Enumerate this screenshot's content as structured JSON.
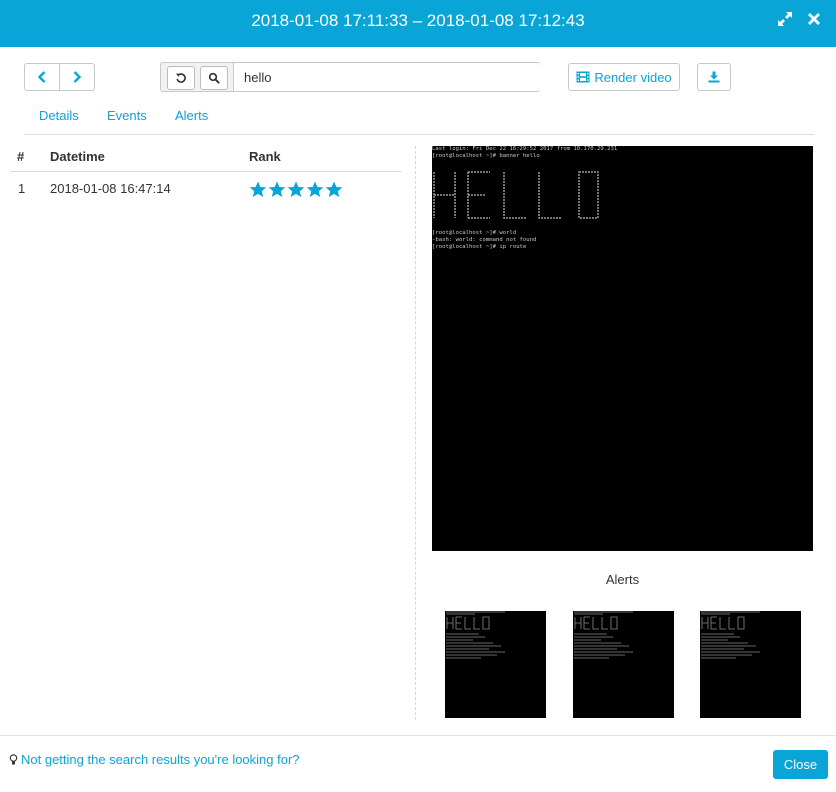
{
  "header": {
    "title": "2018-01-08 17:11:33 – 2018-01-08 17:12:43",
    "expand_icon": "expand-arrows-icon",
    "close_icon": "close-x-icon",
    "bg_color": "#0aa5d7"
  },
  "toolbar": {
    "prev_icon": "chevron-left-icon",
    "next_icon": "chevron-right-icon",
    "reset_icon": "undo-icon",
    "search_icon": "search-icon",
    "search_value": "hello",
    "render_label": "Render video",
    "render_icon": "film-icon",
    "download_icon": "download-icon"
  },
  "tabs": [
    {
      "label": "Details"
    },
    {
      "label": "Events"
    },
    {
      "label": "Alerts"
    }
  ],
  "table": {
    "headers": [
      "#",
      "Datetime",
      "Rank"
    ],
    "rows": [
      {
        "index": "1",
        "datetime": "2018-01-08 16:47:14",
        "rank": 5
      }
    ],
    "star_color": "#0aa5d7"
  },
  "terminal": {
    "lines": [
      "Last login: Fri Dec 22 16:29:52 2017 from 10.170.29.231",
      "[root@localhost ~]# banner hello",
      "",
      "",
      "",
      "",
      "",
      "",
      "",
      "",
      "",
      "[root@localhost ~]# world",
      "-bash: world: command not found",
      "[root@localhost ~]# ip route"
    ]
  },
  "alerts": {
    "title": "Alerts",
    "count": 3
  },
  "footer": {
    "help_icon": "lightbulb-icon",
    "help_text": "Not getting the search results you're looking for?",
    "close_label": "Close"
  }
}
